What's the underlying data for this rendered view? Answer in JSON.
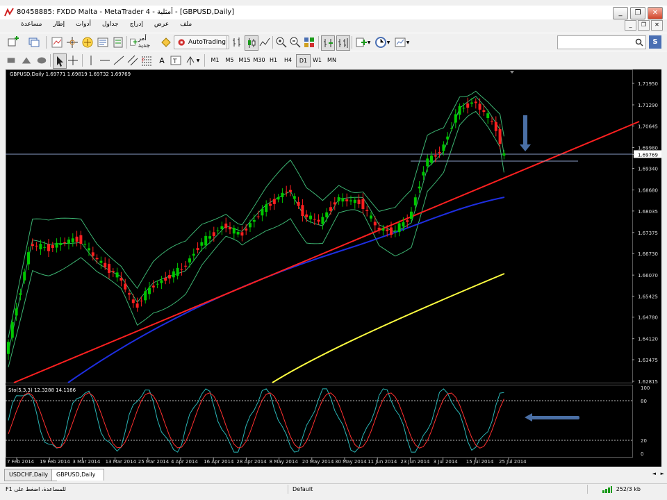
{
  "window": {
    "title": "80458885: FXDD Malta - MetaTrader 4 - أمثلية - [GBPUSD,Daily]",
    "min_label": "_",
    "restore_label": "❐",
    "close_label": "✕"
  },
  "menu": {
    "items": [
      "ملف",
      "عرض",
      "إدراج",
      "جداول",
      "أدوات",
      "إطار",
      "مساعدة"
    ],
    "mdi": [
      "_",
      "❐",
      "✕"
    ]
  },
  "toolbar1": {
    "new_order_label": "أمر جديد",
    "autotrading_label": "AutoTrading",
    "search_placeholder": ""
  },
  "toolbar2": {
    "timeframes": [
      "M1",
      "M5",
      "M15",
      "M30",
      "H1",
      "H4",
      "D1",
      "W1",
      "MN"
    ],
    "active_timeframe": "D1",
    "text_tool": "A"
  },
  "chart": {
    "info": "GBPUSD,Daily  1.69771 1.69819 1.69732 1.69769",
    "price_labels": [
      "1.71950",
      "1.71290",
      "1.70645",
      "1.69980",
      "1.69769",
      "1.69340",
      "1.68680",
      "1.68035",
      "1.67375",
      "1.66730",
      "1.66070",
      "1.65425",
      "1.64780",
      "1.64120",
      "1.63475",
      "1.62815"
    ],
    "current_price": "1.69769",
    "oscillator_info": "Sto(5,3,3) 12.3288 14.1166",
    "oscillator_levels": [
      "100",
      "80",
      "20",
      "0"
    ],
    "date_labels": [
      "7 Feb 2014",
      "19 Feb 2014",
      "3 Mar 2014",
      "13 Mar 2014",
      "25 Mar 2014",
      "4 Apr 2014",
      "16 Apr 2014",
      "28 Apr 2014",
      "8 May 2014",
      "20 May 2014",
      "30 May 2014",
      "11 Jun 2014",
      "23 Jun 2014",
      "3 Jul 2014",
      "15 Jul 2014",
      "25 Jul 2014"
    ],
    "colors": {
      "bull": "#00c800",
      "bear": "#ff2020",
      "bollinger": "#3cb371",
      "ma_blue": "#1e2ee0",
      "ma_yellow": "#ffff40",
      "trendline": "#ff2020",
      "arrow": "#4a6fa5",
      "sto_main": "#2ab5b5",
      "sto_signal": "#ff3030"
    }
  },
  "tabs": [
    "USDCHF,Daily",
    "GBPUSD,Daily"
  ],
  "active_tab": "GBPUSD,Daily",
  "status": {
    "help": "للمساعدة، اضغط على F1",
    "profile": "Default",
    "traffic": "252/3 kb"
  }
}
